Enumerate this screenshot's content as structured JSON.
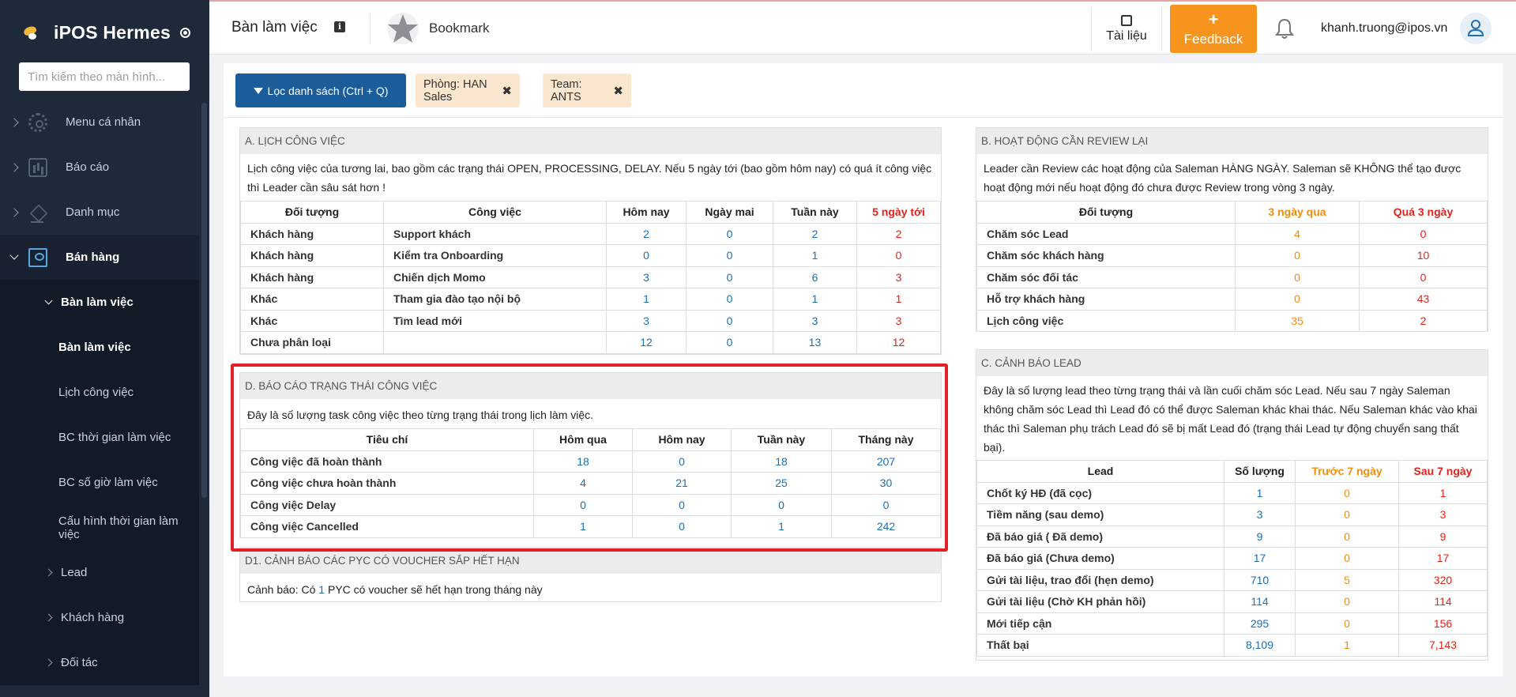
{
  "sidebar": {
    "brand": "iPOS Hermes",
    "search_placeholder": "Tìm kiếm theo màn hình...",
    "items": [
      {
        "label": "Menu cá nhân",
        "icon": "gear-icon"
      },
      {
        "label": "Báo cáo",
        "icon": "chart-icon"
      },
      {
        "label": "Danh mục",
        "icon": "layers-icon"
      },
      {
        "label": "Bán hàng",
        "icon": "id-card-icon"
      }
    ],
    "sub_group": "Bàn làm việc",
    "sub_items": [
      "Bàn làm việc",
      "Lịch công việc",
      "BC thời gian làm việc",
      "BC số giờ làm việc",
      "Cấu hình thời gian làm việc"
    ],
    "more_items": [
      "Lead",
      "Khách hàng",
      "Đối tác"
    ]
  },
  "topbar": {
    "title": "Bàn làm việc",
    "bookmark": "Bookmark",
    "docs": "Tài liệu",
    "feedback_plus": "+",
    "feedback": "Feedback",
    "user": "khanh.truong@ipos.vn"
  },
  "filters": {
    "button": "Lọc danh sách (Ctrl + Q)",
    "chips": [
      "Phòng: HAN Sales",
      "Team: ANTS"
    ]
  },
  "panel_a": {
    "title": "A. LỊCH CÔNG VIỆC",
    "desc": "Lịch công việc của tương lai, bao gồm các trạng thái OPEN, PROCESSING, DELAY. Nếu 5 ngày tới (bao gồm hôm nay) có quá ít công việc thì Leader cần sâu sát hơn !",
    "headers": [
      "Đối tượng",
      "Công việc",
      "Hôm nay",
      "Ngày mai",
      "Tuần này",
      "5 ngày tới"
    ],
    "rows": [
      [
        "Khách hàng",
        "Support khách",
        "2",
        "0",
        "2",
        "2"
      ],
      [
        "Khách hàng",
        "Kiểm tra Onboarding",
        "0",
        "0",
        "1",
        "0"
      ],
      [
        "Khách hàng",
        "Chiến dịch Momo",
        "3",
        "0",
        "6",
        "3"
      ],
      [
        "Khác",
        "Tham gia đào tạo nội bộ",
        "1",
        "0",
        "1",
        "1"
      ],
      [
        "Khác",
        "Tìm lead mới",
        "3",
        "0",
        "3",
        "3"
      ],
      [
        "Chưa phân loại",
        "",
        "12",
        "0",
        "13",
        "12"
      ]
    ]
  },
  "panel_b": {
    "title": "B. HOẠT ĐỘNG CẦN REVIEW LẠI",
    "desc": "Leader cần Review các hoạt động của Saleman HÀNG NGÀY. Saleman sẽ KHÔNG thể tạo được hoạt động mới nếu hoạt động đó chưa được Review trong vòng 3 ngày.",
    "headers": [
      "Đối tượng",
      "3 ngày qua",
      "Quá 3 ngày"
    ],
    "rows": [
      [
        "Chăm sóc Lead",
        "4",
        "0"
      ],
      [
        "Chăm sóc khách hàng",
        "0",
        "10"
      ],
      [
        "Chăm sóc đối tác",
        "0",
        "0"
      ],
      [
        "Hỗ trợ khách hàng",
        "0",
        "43"
      ],
      [
        "Lịch công việc",
        "35",
        "2"
      ]
    ]
  },
  "panel_c": {
    "title": "C. CẢNH BÁO LEAD",
    "desc": "Đây là số lượng lead theo từng trạng thái và lần cuối chăm sóc Lead. Nếu sau 7 ngày Saleman không chăm sóc Lead thì Lead đó có thể được Saleman khác khai thác. Nếu Saleman khác vào khai thác thì Saleman phụ trách Lead đó sẽ bị mất Lead đó (trạng thái Lead tự động chuyển sang thất bại).",
    "headers": [
      "Lead",
      "Số lượng",
      "Trước 7 ngày",
      "Sau 7 ngày"
    ],
    "rows": [
      [
        "Chốt ký HĐ (đã cọc)",
        "1",
        "0",
        "1"
      ],
      [
        "Tiềm năng (sau demo)",
        "3",
        "0",
        "3"
      ],
      [
        "Đã báo giá ( Đã demo)",
        "9",
        "0",
        "9"
      ],
      [
        "Đã báo giá (Chưa demo)",
        "17",
        "0",
        "17"
      ],
      [
        "Gửi tài liệu, trao đổi (hẹn demo)",
        "710",
        "5",
        "320"
      ],
      [
        "Gửi tài liệu (Chờ KH phản hồi)",
        "114",
        "0",
        "114"
      ],
      [
        "Mới tiếp cận",
        "295",
        "0",
        "156"
      ],
      [
        "Thất bại",
        "8,109",
        "1",
        "7,143"
      ]
    ]
  },
  "panel_d": {
    "title": "D. BÁO CÁO TRẠNG THÁI CÔNG VIỆC",
    "desc": "Đây là số lượng task công việc theo từng trạng thái trong lịch làm việc.",
    "headers": [
      "Tiêu chí",
      "Hôm qua",
      "Hôm nay",
      "Tuần này",
      "Tháng này"
    ],
    "rows": [
      [
        "Công việc đã hoàn thành",
        "18",
        "0",
        "18",
        "207"
      ],
      [
        "Công việc chưa hoàn thành",
        "4",
        "21",
        "25",
        "30"
      ],
      [
        "Công việc Delay",
        "0",
        "0",
        "0",
        "0"
      ],
      [
        "Công việc Cancelled",
        "1",
        "0",
        "1",
        "242"
      ]
    ]
  },
  "panel_d1": {
    "title": "D1. CẢNH BÁO CÁC PYC CÓ VOUCHER SẮP HẾT HẠN",
    "desc_before": "Cảnh báo: Có ",
    "count": "1",
    "desc_after": " PYC có voucher sẽ hết hạn trong tháng này"
  },
  "colors": {
    "sidebar": "#1e2a3a",
    "primary": "#1b5c9b",
    "feedback": "#f7941d",
    "alert_red": "#e2231a",
    "warn_orange": "#f28c0f",
    "link_blue": "#1b6fb5",
    "highlight": "#e31e24"
  }
}
